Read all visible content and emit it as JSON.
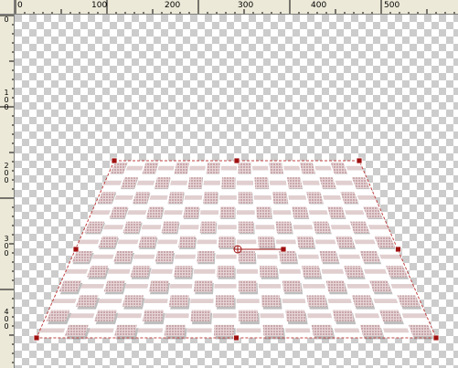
{
  "rulers": {
    "horizontal_labels": [
      "0",
      "100",
      "200",
      "300",
      "400",
      "500"
    ],
    "vertical_labels": [
      "0",
      "100",
      "200",
      "300",
      "400"
    ]
  },
  "canvas": {
    "transparency_checker_colors": [
      "#ffffff",
      "#cccccc"
    ],
    "plane_tile_color": "#c9a7aa",
    "plane_shadow_color": "#888888",
    "handle_color": "#a01010",
    "bounding_line_color": "#c04040"
  }
}
